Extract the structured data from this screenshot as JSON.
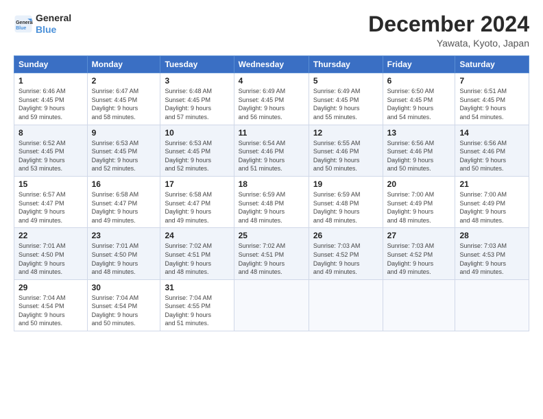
{
  "logo": {
    "line1": "General",
    "line2": "Blue"
  },
  "header": {
    "month": "December 2024",
    "location": "Yawata, Kyoto, Japan"
  },
  "days_of_week": [
    "Sunday",
    "Monday",
    "Tuesday",
    "Wednesday",
    "Thursday",
    "Friday",
    "Saturday"
  ],
  "weeks": [
    [
      {
        "day": "1",
        "sunrise": "6:46 AM",
        "sunset": "4:45 PM",
        "daylight_h": "9",
        "daylight_m": "59"
      },
      {
        "day": "2",
        "sunrise": "6:47 AM",
        "sunset": "4:45 PM",
        "daylight_h": "9",
        "daylight_m": "58"
      },
      {
        "day": "3",
        "sunrise": "6:48 AM",
        "sunset": "4:45 PM",
        "daylight_h": "9",
        "daylight_m": "57"
      },
      {
        "day": "4",
        "sunrise": "6:49 AM",
        "sunset": "4:45 PM",
        "daylight_h": "9",
        "daylight_m": "56"
      },
      {
        "day": "5",
        "sunrise": "6:49 AM",
        "sunset": "4:45 PM",
        "daylight_h": "9",
        "daylight_m": "55"
      },
      {
        "day": "6",
        "sunrise": "6:50 AM",
        "sunset": "4:45 PM",
        "daylight_h": "9",
        "daylight_m": "54"
      },
      {
        "day": "7",
        "sunrise": "6:51 AM",
        "sunset": "4:45 PM",
        "daylight_h": "9",
        "daylight_m": "54"
      }
    ],
    [
      {
        "day": "8",
        "sunrise": "6:52 AM",
        "sunset": "4:45 PM",
        "daylight_h": "9",
        "daylight_m": "53"
      },
      {
        "day": "9",
        "sunrise": "6:53 AM",
        "sunset": "4:45 PM",
        "daylight_h": "9",
        "daylight_m": "52"
      },
      {
        "day": "10",
        "sunrise": "6:53 AM",
        "sunset": "4:45 PM",
        "daylight_h": "9",
        "daylight_m": "52"
      },
      {
        "day": "11",
        "sunrise": "6:54 AM",
        "sunset": "4:46 PM",
        "daylight_h": "9",
        "daylight_m": "51"
      },
      {
        "day": "12",
        "sunrise": "6:55 AM",
        "sunset": "4:46 PM",
        "daylight_h": "9",
        "daylight_m": "50"
      },
      {
        "day": "13",
        "sunrise": "6:56 AM",
        "sunset": "4:46 PM",
        "daylight_h": "9",
        "daylight_m": "50"
      },
      {
        "day": "14",
        "sunrise": "6:56 AM",
        "sunset": "4:46 PM",
        "daylight_h": "9",
        "daylight_m": "50"
      }
    ],
    [
      {
        "day": "15",
        "sunrise": "6:57 AM",
        "sunset": "4:47 PM",
        "daylight_h": "9",
        "daylight_m": "49"
      },
      {
        "day": "16",
        "sunrise": "6:58 AM",
        "sunset": "4:47 PM",
        "daylight_h": "9",
        "daylight_m": "49"
      },
      {
        "day": "17",
        "sunrise": "6:58 AM",
        "sunset": "4:47 PM",
        "daylight_h": "9",
        "daylight_m": "49"
      },
      {
        "day": "18",
        "sunrise": "6:59 AM",
        "sunset": "4:48 PM",
        "daylight_h": "9",
        "daylight_m": "48"
      },
      {
        "day": "19",
        "sunrise": "6:59 AM",
        "sunset": "4:48 PM",
        "daylight_h": "9",
        "daylight_m": "48"
      },
      {
        "day": "20",
        "sunrise": "7:00 AM",
        "sunset": "4:49 PM",
        "daylight_h": "9",
        "daylight_m": "48"
      },
      {
        "day": "21",
        "sunrise": "7:00 AM",
        "sunset": "4:49 PM",
        "daylight_h": "9",
        "daylight_m": "48"
      }
    ],
    [
      {
        "day": "22",
        "sunrise": "7:01 AM",
        "sunset": "4:50 PM",
        "daylight_h": "9",
        "daylight_m": "48"
      },
      {
        "day": "23",
        "sunrise": "7:01 AM",
        "sunset": "4:50 PM",
        "daylight_h": "9",
        "daylight_m": "48"
      },
      {
        "day": "24",
        "sunrise": "7:02 AM",
        "sunset": "4:51 PM",
        "daylight_h": "9",
        "daylight_m": "48"
      },
      {
        "day": "25",
        "sunrise": "7:02 AM",
        "sunset": "4:51 PM",
        "daylight_h": "9",
        "daylight_m": "48"
      },
      {
        "day": "26",
        "sunrise": "7:03 AM",
        "sunset": "4:52 PM",
        "daylight_h": "9",
        "daylight_m": "49"
      },
      {
        "day": "27",
        "sunrise": "7:03 AM",
        "sunset": "4:52 PM",
        "daylight_h": "9",
        "daylight_m": "49"
      },
      {
        "day": "28",
        "sunrise": "7:03 AM",
        "sunset": "4:53 PM",
        "daylight_h": "9",
        "daylight_m": "49"
      }
    ],
    [
      {
        "day": "29",
        "sunrise": "7:04 AM",
        "sunset": "4:54 PM",
        "daylight_h": "9",
        "daylight_m": "50"
      },
      {
        "day": "30",
        "sunrise": "7:04 AM",
        "sunset": "4:54 PM",
        "daylight_h": "9",
        "daylight_m": "50"
      },
      {
        "day": "31",
        "sunrise": "7:04 AM",
        "sunset": "4:55 PM",
        "daylight_h": "9",
        "daylight_m": "51"
      },
      null,
      null,
      null,
      null
    ]
  ],
  "labels": {
    "sunrise": "Sunrise:",
    "sunset": "Sunset:",
    "daylight": "Daylight:"
  }
}
